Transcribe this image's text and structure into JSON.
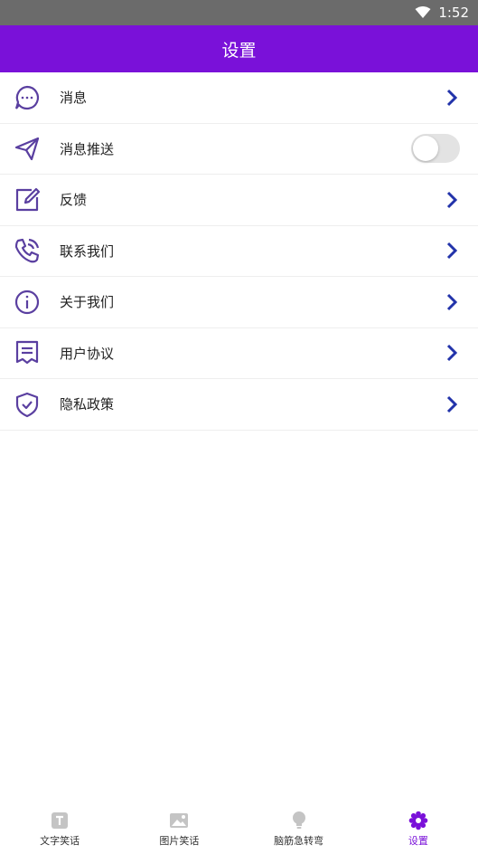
{
  "status_bar": {
    "time": "1:52"
  },
  "app_bar": {
    "title": "设置"
  },
  "colors": {
    "accent": "#7a11d9",
    "icon": "#5a3fa0",
    "chevron": "#2233aa",
    "toggle_off": "#e3e3e3"
  },
  "settings": {
    "items": [
      {
        "label": "消息",
        "icon": "message-dots-icon",
        "control": "chevron"
      },
      {
        "label": "消息推送",
        "icon": "paper-plane-icon",
        "control": "toggle",
        "toggle_on": false
      },
      {
        "label": "反馈",
        "icon": "edit-note-icon",
        "control": "chevron"
      },
      {
        "label": "联系我们",
        "icon": "phone-call-icon",
        "control": "chevron"
      },
      {
        "label": "关于我们",
        "icon": "info-circle-icon",
        "control": "chevron"
      },
      {
        "label": "用户协议",
        "icon": "document-icon",
        "control": "chevron"
      },
      {
        "label": "隐私政策",
        "icon": "shield-check-icon",
        "control": "chevron"
      }
    ]
  },
  "bottom_nav": {
    "items": [
      {
        "label": "文字笑话",
        "icon": "text-icon",
        "active": false
      },
      {
        "label": "图片笑话",
        "icon": "image-icon",
        "active": false
      },
      {
        "label": "脑筋急转弯",
        "icon": "lightbulb-icon",
        "active": false
      },
      {
        "label": "设置",
        "icon": "settings-gear-icon",
        "active": true
      }
    ]
  }
}
